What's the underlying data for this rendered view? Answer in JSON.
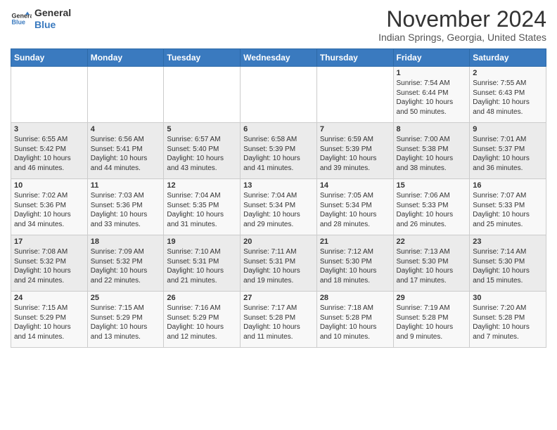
{
  "logo": {
    "text_general": "General",
    "text_blue": "Blue"
  },
  "header": {
    "month": "November 2024",
    "location": "Indian Springs, Georgia, United States"
  },
  "weekdays": [
    "Sunday",
    "Monday",
    "Tuesday",
    "Wednesday",
    "Thursday",
    "Friday",
    "Saturday"
  ],
  "weeks": [
    [
      {
        "day": "",
        "info": ""
      },
      {
        "day": "",
        "info": ""
      },
      {
        "day": "",
        "info": ""
      },
      {
        "day": "",
        "info": ""
      },
      {
        "day": "",
        "info": ""
      },
      {
        "day": "1",
        "info": "Sunrise: 7:54 AM\nSunset: 6:44 PM\nDaylight: 10 hours\nand 50 minutes."
      },
      {
        "day": "2",
        "info": "Sunrise: 7:55 AM\nSunset: 6:43 PM\nDaylight: 10 hours\nand 48 minutes."
      }
    ],
    [
      {
        "day": "3",
        "info": "Sunrise: 6:55 AM\nSunset: 5:42 PM\nDaylight: 10 hours\nand 46 minutes."
      },
      {
        "day": "4",
        "info": "Sunrise: 6:56 AM\nSunset: 5:41 PM\nDaylight: 10 hours\nand 44 minutes."
      },
      {
        "day": "5",
        "info": "Sunrise: 6:57 AM\nSunset: 5:40 PM\nDaylight: 10 hours\nand 43 minutes."
      },
      {
        "day": "6",
        "info": "Sunrise: 6:58 AM\nSunset: 5:39 PM\nDaylight: 10 hours\nand 41 minutes."
      },
      {
        "day": "7",
        "info": "Sunrise: 6:59 AM\nSunset: 5:39 PM\nDaylight: 10 hours\nand 39 minutes."
      },
      {
        "day": "8",
        "info": "Sunrise: 7:00 AM\nSunset: 5:38 PM\nDaylight: 10 hours\nand 38 minutes."
      },
      {
        "day": "9",
        "info": "Sunrise: 7:01 AM\nSunset: 5:37 PM\nDaylight: 10 hours\nand 36 minutes."
      }
    ],
    [
      {
        "day": "10",
        "info": "Sunrise: 7:02 AM\nSunset: 5:36 PM\nDaylight: 10 hours\nand 34 minutes."
      },
      {
        "day": "11",
        "info": "Sunrise: 7:03 AM\nSunset: 5:36 PM\nDaylight: 10 hours\nand 33 minutes."
      },
      {
        "day": "12",
        "info": "Sunrise: 7:04 AM\nSunset: 5:35 PM\nDaylight: 10 hours\nand 31 minutes."
      },
      {
        "day": "13",
        "info": "Sunrise: 7:04 AM\nSunset: 5:34 PM\nDaylight: 10 hours\nand 29 minutes."
      },
      {
        "day": "14",
        "info": "Sunrise: 7:05 AM\nSunset: 5:34 PM\nDaylight: 10 hours\nand 28 minutes."
      },
      {
        "day": "15",
        "info": "Sunrise: 7:06 AM\nSunset: 5:33 PM\nDaylight: 10 hours\nand 26 minutes."
      },
      {
        "day": "16",
        "info": "Sunrise: 7:07 AM\nSunset: 5:33 PM\nDaylight: 10 hours\nand 25 minutes."
      }
    ],
    [
      {
        "day": "17",
        "info": "Sunrise: 7:08 AM\nSunset: 5:32 PM\nDaylight: 10 hours\nand 24 minutes."
      },
      {
        "day": "18",
        "info": "Sunrise: 7:09 AM\nSunset: 5:32 PM\nDaylight: 10 hours\nand 22 minutes."
      },
      {
        "day": "19",
        "info": "Sunrise: 7:10 AM\nSunset: 5:31 PM\nDaylight: 10 hours\nand 21 minutes."
      },
      {
        "day": "20",
        "info": "Sunrise: 7:11 AM\nSunset: 5:31 PM\nDaylight: 10 hours\nand 19 minutes."
      },
      {
        "day": "21",
        "info": "Sunrise: 7:12 AM\nSunset: 5:30 PM\nDaylight: 10 hours\nand 18 minutes."
      },
      {
        "day": "22",
        "info": "Sunrise: 7:13 AM\nSunset: 5:30 PM\nDaylight: 10 hours\nand 17 minutes."
      },
      {
        "day": "23",
        "info": "Sunrise: 7:14 AM\nSunset: 5:30 PM\nDaylight: 10 hours\nand 15 minutes."
      }
    ],
    [
      {
        "day": "24",
        "info": "Sunrise: 7:15 AM\nSunset: 5:29 PM\nDaylight: 10 hours\nand 14 minutes."
      },
      {
        "day": "25",
        "info": "Sunrise: 7:15 AM\nSunset: 5:29 PM\nDaylight: 10 hours\nand 13 minutes."
      },
      {
        "day": "26",
        "info": "Sunrise: 7:16 AM\nSunset: 5:29 PM\nDaylight: 10 hours\nand 12 minutes."
      },
      {
        "day": "27",
        "info": "Sunrise: 7:17 AM\nSunset: 5:28 PM\nDaylight: 10 hours\nand 11 minutes."
      },
      {
        "day": "28",
        "info": "Sunrise: 7:18 AM\nSunset: 5:28 PM\nDaylight: 10 hours\nand 10 minutes."
      },
      {
        "day": "29",
        "info": "Sunrise: 7:19 AM\nSunset: 5:28 PM\nDaylight: 10 hours\nand 9 minutes."
      },
      {
        "day": "30",
        "info": "Sunrise: 7:20 AM\nSunset: 5:28 PM\nDaylight: 10 hours\nand 7 minutes."
      }
    ]
  ]
}
